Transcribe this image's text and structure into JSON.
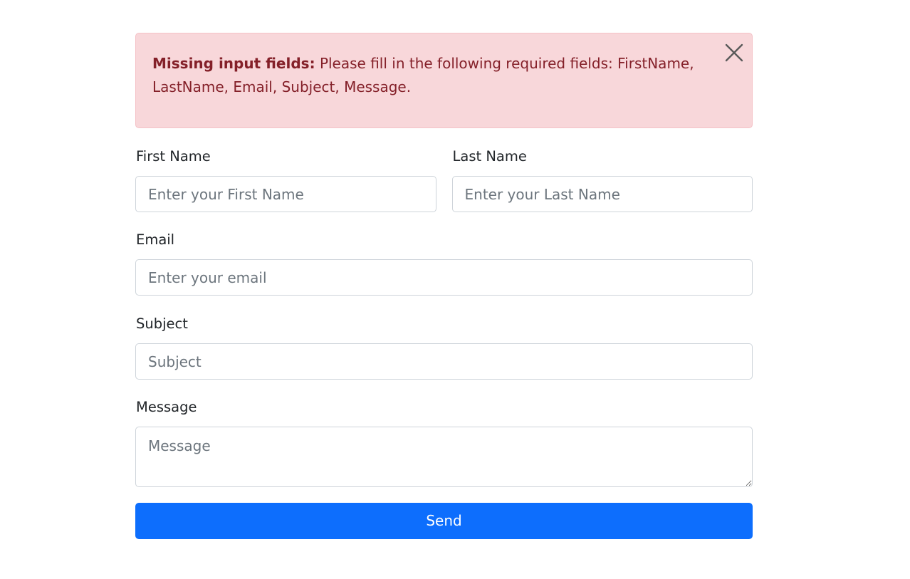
{
  "alert": {
    "title": "Missing input fields:",
    "message": "Please fill in the following required fields: FirstName, LastName, Email, Subject, Message.",
    "close_icon": "close-icon",
    "background": "#f8d7da",
    "text_color": "#842029"
  },
  "form": {
    "first_name": {
      "label": "First Name",
      "placeholder": "Enter your First Name",
      "value": ""
    },
    "last_name": {
      "label": "Last Name",
      "placeholder": "Enter your Last Name",
      "value": ""
    },
    "email": {
      "label": "Email",
      "placeholder": "Enter your email",
      "value": ""
    },
    "subject": {
      "label": "Subject",
      "placeholder": "Subject",
      "value": ""
    },
    "message": {
      "label": "Message",
      "placeholder": "Message",
      "value": ""
    },
    "submit_label": "Send",
    "submit_color": "#0d6efd"
  }
}
